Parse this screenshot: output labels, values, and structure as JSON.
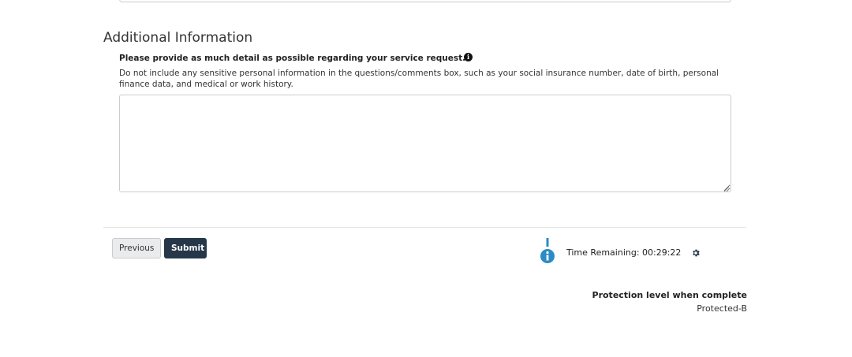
{
  "section": {
    "heading": "Additional Information"
  },
  "comments": {
    "label": "Please provide as much detail as possible regarding your service request.",
    "info_icon": "info-circle-icon",
    "hint": "Do not include any sensitive personal information in the questions/comments box, such as your social insurance number, date of birth, personal finance data, and medical or work history.",
    "value": ""
  },
  "actions": {
    "previous_label": "Previous",
    "submit_label": "Submit",
    "submit_color": "#26374a"
  },
  "session": {
    "timer_icon": "timer-info-icon",
    "time_remaining": "Time Remaining: 00:29:22",
    "settings_icon": "gear-icon",
    "icon_color": "#2b8cc4"
  },
  "protection": {
    "title": "Protection level when complete",
    "level": "Protected-B"
  }
}
